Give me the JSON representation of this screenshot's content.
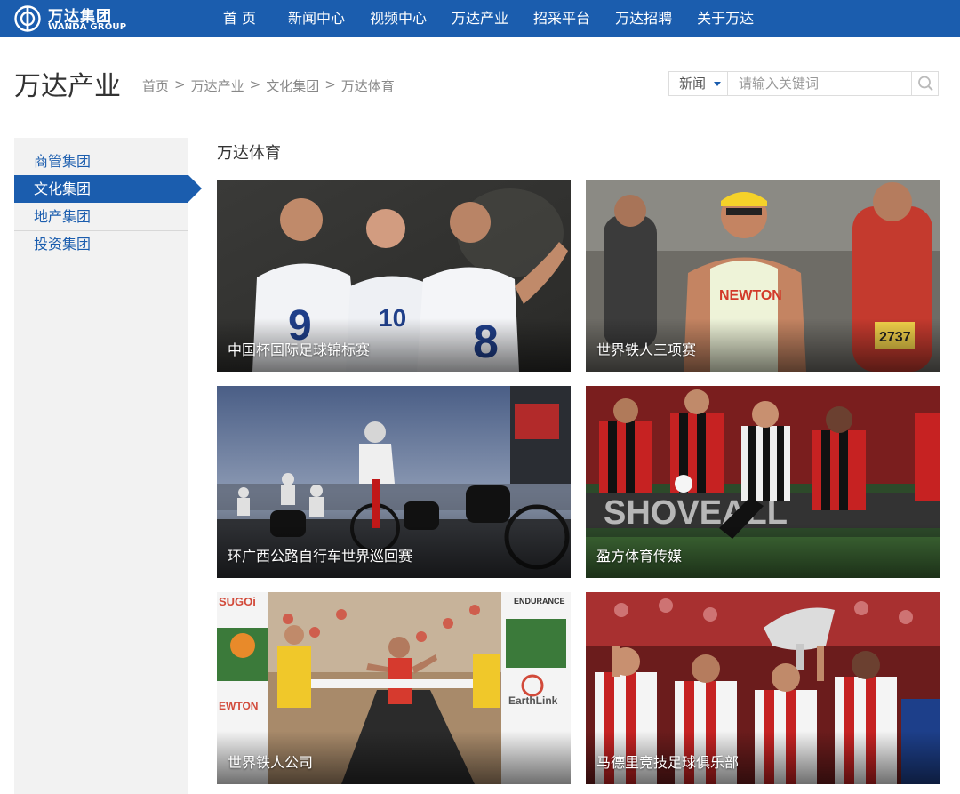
{
  "brand": {
    "name_cn": "万达集团",
    "name_en": "WANDA GROUP",
    "color": "#1b5dae"
  },
  "nav": {
    "items": [
      "首 页",
      "新闻中心",
      "视频中心",
      "万达产业",
      "招采平台",
      "万达招聘",
      "关于万达"
    ]
  },
  "header": {
    "title": "万达产业",
    "breadcrumb": [
      "首页",
      "万达产业",
      "文化集团",
      "万达体育"
    ],
    "separator": ">"
  },
  "search": {
    "type_label": "新闻",
    "placeholder": "请输入关键词",
    "icon": "search-icon"
  },
  "sidebar": {
    "items": [
      {
        "label": "商管集团",
        "active": false
      },
      {
        "label": "文化集团",
        "active": true
      },
      {
        "label": "地产集团",
        "active": false
      },
      {
        "label": "投资集团",
        "active": false
      }
    ]
  },
  "main": {
    "title": "万达体育",
    "cards": [
      {
        "label": "中国杯国际足球锦标赛"
      },
      {
        "label": "世界铁人三项赛"
      },
      {
        "label": "环广西公路自行车世界巡回赛"
      },
      {
        "label": "盈方体育传媒"
      },
      {
        "label": "世界铁人公司"
      },
      {
        "label": "马德里竞技足球俱乐部"
      }
    ]
  }
}
